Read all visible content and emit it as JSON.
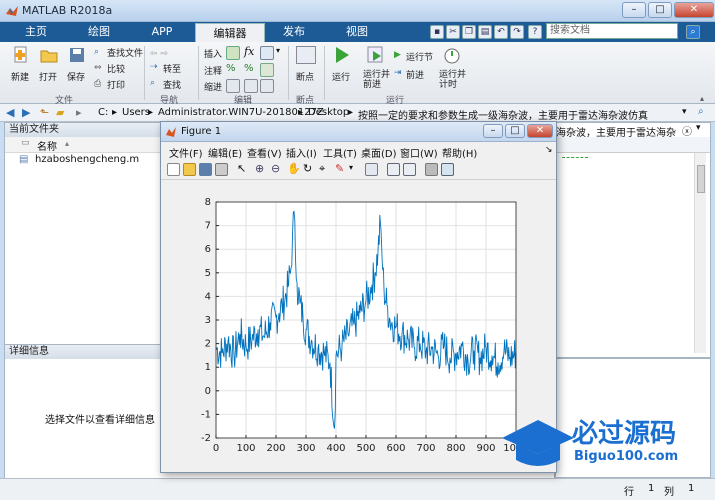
{
  "window": {
    "title": "MATLAB R2018a"
  },
  "tabs": [
    {
      "label": "主页"
    },
    {
      "label": "绘图"
    },
    {
      "label": "APP"
    },
    {
      "label": "编辑器"
    },
    {
      "label": "发布"
    },
    {
      "label": "视图"
    }
  ],
  "search": {
    "placeholder": "搜索文档"
  },
  "ribbon": {
    "new": "新建",
    "open": "打开",
    "save": "保存",
    "find_files": "查找文件",
    "compare": "比较",
    "print": "打印",
    "goto": "转至",
    "find": "查找",
    "insert": "插入",
    "comment": "注释",
    "indent": "缩进",
    "breakpoint": "断点",
    "run": "运行",
    "run_advance": "运行并\n前进",
    "run_section": "运行节",
    "advance": "前进",
    "run_time": "运行并\n计时",
    "groups": {
      "file": "文件",
      "nav": "导航",
      "edit": "编辑",
      "breakpoints": "断点",
      "run": "运行"
    }
  },
  "address": {
    "segments": [
      "C:",
      "Users",
      "Administrator.WIN7U-20180127Z",
      "Desktop",
      "按照一定的要求和参数生成一级海杂波，主要用于雷达海杂波仿真"
    ]
  },
  "current_folder": {
    "title": "当前文件夹",
    "column": "名称",
    "files": [
      "hzaboshengcheng.m"
    ]
  },
  "details": {
    "title": "详细信息",
    "message": "选择文件以查看详细信息"
  },
  "editor_tab": "海杂波，主要用于雷达海杂波仿真",
  "status": {
    "row_label": "行",
    "row": "1",
    "col_label": "列",
    "col": "1"
  },
  "figure": {
    "title": "Figure 1",
    "menu": [
      "文件(F)",
      "编辑(E)",
      "查看(V)",
      "插入(I)",
      "工具(T)",
      "桌面(D)",
      "窗口(W)",
      "帮助(H)"
    ]
  },
  "watermark": {
    "line1": "必过源码",
    "line2": "Biguo100.com"
  },
  "chart_data": {
    "type": "line",
    "title": "",
    "xlabel": "",
    "ylabel": "",
    "xlim": [
      0,
      1000
    ],
    "ylim": [
      -2,
      8
    ],
    "xticks": [
      0,
      100,
      200,
      300,
      400,
      500,
      600,
      700,
      800,
      900,
      1000
    ],
    "yticks": [
      -2,
      -1,
      0,
      1,
      2,
      3,
      4,
      5,
      6,
      7,
      8
    ],
    "grid": true,
    "color": "#0072bd",
    "series": [
      {
        "x": [
          0,
          20,
          40,
          60,
          80,
          100,
          120,
          140,
          160,
          180,
          200,
          210,
          220,
          230,
          240,
          250,
          255,
          260,
          265,
          270,
          280,
          290,
          300,
          320,
          340,
          360,
          380,
          395,
          400,
          420,
          440,
          460,
          480,
          500,
          520,
          530,
          540,
          548,
          552,
          556,
          560,
          570,
          580,
          600,
          620,
          640,
          660,
          680,
          700,
          720,
          740,
          760,
          780,
          800,
          820,
          840,
          860,
          880,
          900,
          920,
          940,
          960,
          980,
          1000
        ],
        "y": [
          1.8,
          1.6,
          2.1,
          1.5,
          2.4,
          1.9,
          2.2,
          2.6,
          2.3,
          2.9,
          3.1,
          3.3,
          3.6,
          3.9,
          4.4,
          5.2,
          6.6,
          7.6,
          5.6,
          4.6,
          3.7,
          3.1,
          2.6,
          2.1,
          1.8,
          1.6,
          1.2,
          -1.6,
          1.5,
          1.9,
          2.4,
          2.8,
          3.3,
          3.8,
          4.5,
          5.0,
          5.9,
          7.1,
          6.2,
          5.1,
          4.3,
          3.6,
          3.0,
          2.7,
          2.4,
          2.2,
          1.9,
          2.0,
          1.7,
          1.8,
          1.5,
          1.9,
          1.4,
          1.6,
          1.9,
          1.3,
          1.7,
          1.4,
          1.8,
          1.5,
          1.2,
          1.7,
          1.4,
          1.6
        ]
      }
    ]
  }
}
